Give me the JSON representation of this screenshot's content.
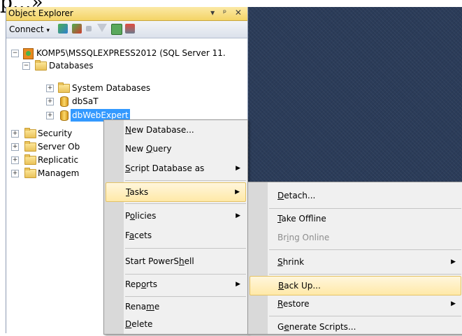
{
  "top_text": "р...»",
  "panel": {
    "title": "Object Explorer",
    "title_buttons": "▾ ᵖ ✕",
    "connect_label": "Connect",
    "connect_arrow": "▾"
  },
  "tree": {
    "server": "KOMP5\\MSSQLEXPRESS2012 (SQL Server 11.",
    "databases": "Databases",
    "system_databases": "System Databases",
    "db1": "dbSaT",
    "db2": "dbWebExpert",
    "security": "Security",
    "server_objects": "Server Ob",
    "replication": "Replicatic",
    "management": "Managem"
  },
  "menu1": {
    "items": [
      {
        "pre": "",
        "ul": "N",
        "post": "ew Database...",
        "arrow": ""
      },
      {
        "pre": "New ",
        "ul": "Q",
        "post": "uery",
        "arrow": ""
      },
      {
        "pre": "",
        "ul": "S",
        "post": "cript Database as",
        "arrow": "▶"
      },
      {
        "pre": "",
        "ul": "T",
        "post": "asks",
        "arrow": "▶"
      },
      {
        "pre": "P",
        "ul": "o",
        "post": "licies",
        "arrow": "▶"
      },
      {
        "pre": "F",
        "ul": "a",
        "post": "cets",
        "arrow": ""
      },
      {
        "pre": "Start PowerS",
        "ul": "h",
        "post": "ell",
        "arrow": ""
      },
      {
        "pre": "Rep",
        "ul": "o",
        "post": "rts",
        "arrow": "▶"
      },
      {
        "pre": "Rena",
        "ul": "m",
        "post": "e",
        "arrow": ""
      },
      {
        "pre": "",
        "ul": "D",
        "post": "elete",
        "arrow": ""
      }
    ]
  },
  "menu2": {
    "items": [
      {
        "pre": "",
        "ul": "D",
        "post": "etach...",
        "arrow": ""
      },
      {
        "pre": "",
        "ul": "T",
        "post": "ake Offline",
        "arrow": ""
      },
      {
        "pre": "Br",
        "ul": "i",
        "post": "ng Online",
        "arrow": ""
      },
      {
        "pre": "",
        "ul": "S",
        "post": "hrink",
        "arrow": "▶"
      },
      {
        "pre": "",
        "ul": "B",
        "post": "ack Up...",
        "arrow": ""
      },
      {
        "pre": "",
        "ul": "R",
        "post": "estore",
        "arrow": "▶"
      },
      {
        "pre": "G",
        "ul": "e",
        "post": "nerate Scripts...",
        "arrow": ""
      }
    ]
  },
  "colors": {
    "selection": "#3399ff",
    "highlight": "#ffe9a8",
    "document_bg": "#2b3c59"
  }
}
